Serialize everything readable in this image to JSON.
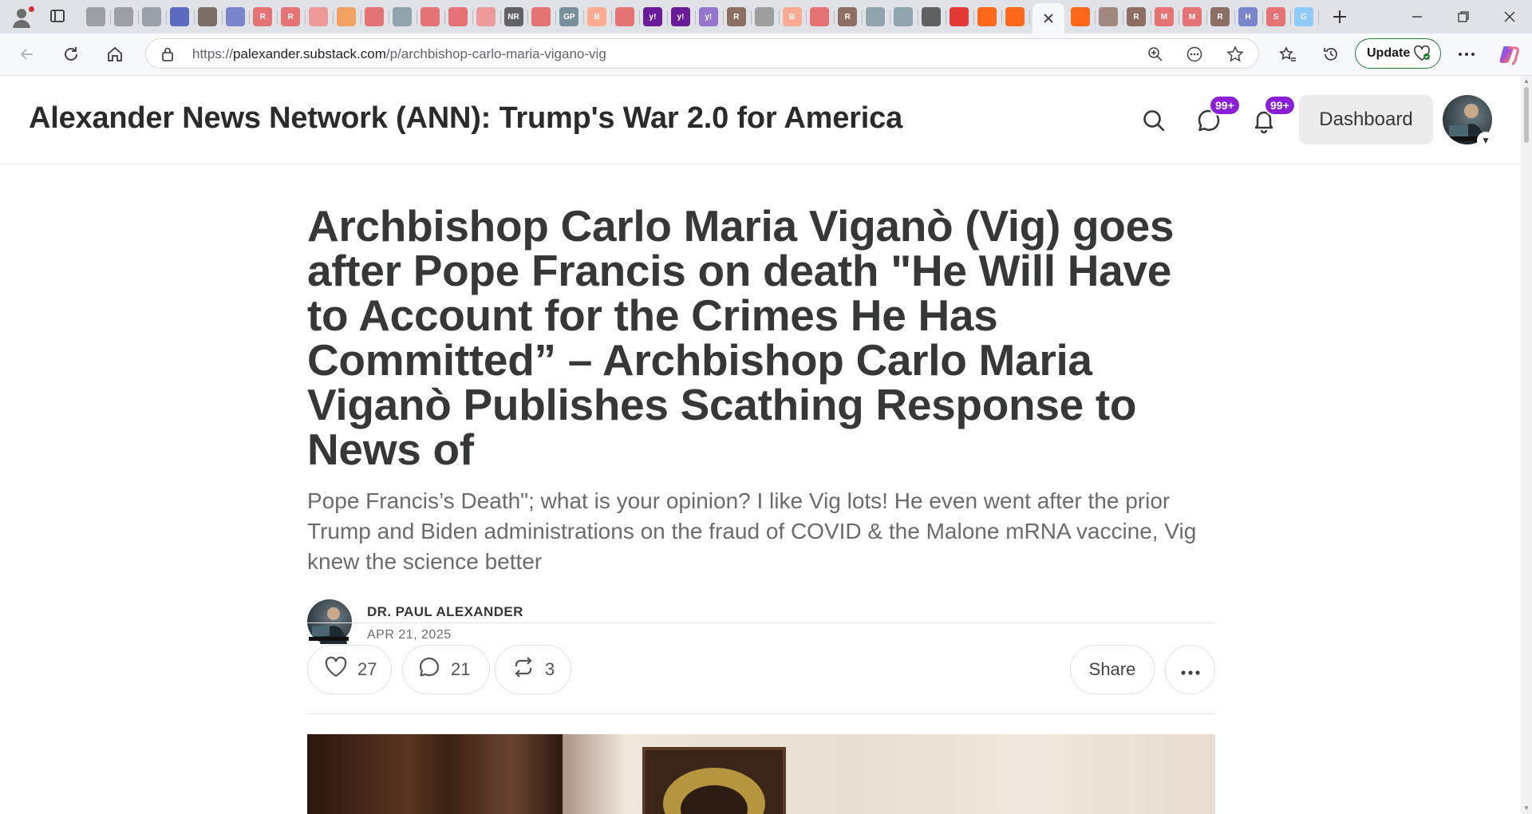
{
  "browser": {
    "tab_strip": {
      "favicons": [
        {
          "icon": "globe-icon",
          "color": "#9aa0a6",
          "text": ""
        },
        {
          "icon": "globe-icon",
          "color": "#9aa0a6",
          "text": ""
        },
        {
          "icon": "globe-icon",
          "color": "#9aa0a6",
          "text": ""
        },
        {
          "icon": "news-icon",
          "color": "#5c6bc0",
          "text": ""
        },
        {
          "icon": "document-icon",
          "color": "#7b6e66",
          "text": ""
        },
        {
          "icon": "arrow-icon",
          "color": "#7986cb",
          "text": ""
        },
        {
          "icon": "r-logo-icon",
          "color": "#e57373",
          "text": "R"
        },
        {
          "icon": "r-logo-icon",
          "color": "#e57373",
          "text": "R"
        },
        {
          "icon": "document-icon",
          "color": "#ef9a9a",
          "text": ""
        },
        {
          "icon": "circle-icon",
          "color": "#f4a261",
          "text": ""
        },
        {
          "icon": "youtube-icon",
          "color": "#e57373",
          "text": ""
        },
        {
          "icon": "feather-icon",
          "color": "#90a4ae",
          "text": ""
        },
        {
          "icon": "youtube-icon",
          "color": "#e57373",
          "text": ""
        },
        {
          "icon": "youtube-icon",
          "color": "#e57373",
          "text": ""
        },
        {
          "icon": "document-icon",
          "color": "#ef9a9a",
          "text": ""
        },
        {
          "icon": "nr-logo-icon",
          "color": "#5f6368",
          "text": "NR"
        },
        {
          "icon": "youtube-icon",
          "color": "#e57373",
          "text": ""
        },
        {
          "icon": "gp-logo-icon",
          "color": "#78909c",
          "text": "GP"
        },
        {
          "icon": "b-logo-icon",
          "color": "#ffab91",
          "text": "B"
        },
        {
          "icon": "youtube-icon",
          "color": "#e57373",
          "text": ""
        },
        {
          "icon": "yahoo-icon",
          "color": "#6a1b9a",
          "text": "y!"
        },
        {
          "icon": "yahoo-icon",
          "color": "#6a1b9a",
          "text": "y!"
        },
        {
          "icon": "yahoo-icon",
          "color": "#9575cd",
          "text": "y!"
        },
        {
          "icon": "r-logo-icon",
          "color": "#8d6e63",
          "text": "R"
        },
        {
          "icon": "chart-icon",
          "color": "#9e9e9e",
          "text": ""
        },
        {
          "icon": "b-logo-icon",
          "color": "#ffab91",
          "text": "B"
        },
        {
          "icon": "youtube-icon",
          "color": "#e57373",
          "text": ""
        },
        {
          "icon": "r-logo-icon",
          "color": "#8d6e63",
          "text": "R"
        },
        {
          "icon": "search-icon",
          "color": "#90a4ae",
          "text": ""
        },
        {
          "icon": "search-icon",
          "color": "#90a4ae",
          "text": ""
        },
        {
          "icon": "stripes-icon",
          "color": "#616161",
          "text": ""
        },
        {
          "icon": "youtube-icon",
          "color": "#e53935",
          "text": ""
        },
        {
          "icon": "substack-icon",
          "color": "#ff6719",
          "text": ""
        },
        {
          "icon": "substack-icon",
          "color": "#ff6719",
          "text": ""
        }
      ],
      "favicons_after_active": [
        {
          "icon": "substack-icon",
          "color": "#ff6719",
          "text": ""
        },
        {
          "icon": "image-icon",
          "color": "#a1887f",
          "text": ""
        },
        {
          "icon": "r-logo-icon",
          "color": "#8d6e63",
          "text": "R"
        },
        {
          "icon": "m-logo-icon",
          "color": "#e57373",
          "text": "M"
        },
        {
          "icon": "m-logo-icon",
          "color": "#e57373",
          "text": "M"
        },
        {
          "icon": "r-logo-icon",
          "color": "#8d6e63",
          "text": "R"
        },
        {
          "icon": "h-logo-icon",
          "color": "#7986cb",
          "text": "H"
        },
        {
          "icon": "s-logo-icon",
          "color": "#e57373",
          "text": "S"
        },
        {
          "icon": "google-icon",
          "color": "#90caf9",
          "text": "G"
        }
      ]
    },
    "address_bar": {
      "url_prefix": "https://",
      "url_host": "palexander.substack.com",
      "url_path": "/p/archbishop-carlo-maria-vigano-vig",
      "update_label": "Update"
    }
  },
  "site": {
    "title": "Alexander News Network (ANN): Trump's War 2.0 for America",
    "chat_badge": "99+",
    "notification_badge": "99+",
    "dashboard_label": "Dashboard"
  },
  "article": {
    "headline": "Archbishop Carlo Maria Viganò (Vig) goes after Pope Francis on death \"He Will Have to Account for the Crimes He Has Committed” – Archbishop Carlo Maria Viganò Publishes Scathing Response to News of",
    "subtitle": "Pope Francis’s Death\"; what is your opinion? I like Vig lots! He even went after the prior Trump and Biden administrations on the fraud of COVID & the Malone mRNA vaccine, Vig knew the science better",
    "author": "DR. PAUL ALEXANDER",
    "date": "APR 21, 2025",
    "likes": "27",
    "comments": "21",
    "restacks": "3",
    "share_label": "Share"
  },
  "colors": {
    "accent_purple": "#8b1fd8",
    "update_green": "#1e7b34",
    "text_dark": "#363737"
  }
}
